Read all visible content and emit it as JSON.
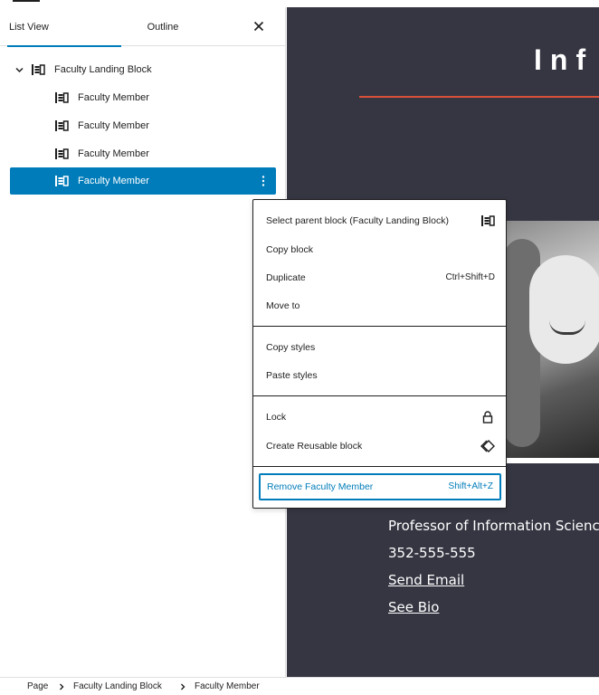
{
  "sidebar": {
    "tabs": [
      {
        "label": "List View",
        "active": true
      },
      {
        "label": "Outline",
        "active": false
      }
    ],
    "close_icon": "close-icon",
    "tree": [
      {
        "label": "Faculty Landing Block",
        "level": 1,
        "expanded": true
      },
      {
        "label": "Faculty Member",
        "level": 2
      },
      {
        "label": "Faculty Member",
        "level": 2
      },
      {
        "label": "Faculty Member",
        "level": 2
      },
      {
        "label": "Faculty Member",
        "level": 2,
        "selected": true
      }
    ]
  },
  "canvas": {
    "heading": "Inf",
    "info": [
      "Professor of Information Science",
      "352-555-555",
      "Send Email",
      "See Bio"
    ]
  },
  "menu": {
    "items": [
      {
        "label": "Select parent block (Faculty Landing Block)",
        "icon": "block-icon"
      },
      {
        "label": "Copy block"
      },
      {
        "label": "Duplicate",
        "shortcut": "Ctrl+Shift+D"
      },
      {
        "label": "Move to"
      },
      {
        "label": "Copy styles"
      },
      {
        "label": "Paste styles"
      },
      {
        "label": "Lock",
        "icon": "lock-icon"
      },
      {
        "label": "Create Reusable block",
        "icon": "reusable-icon"
      },
      {
        "label": "Remove Faculty Member",
        "shortcut": "Shift+Alt+Z"
      }
    ]
  },
  "breadcrumb": [
    "Page",
    "Faculty Landing Block",
    "Faculty Member"
  ],
  "colors": {
    "accent": "#007cba",
    "canvas_bg": "#353642",
    "heading_rule": "#d9503a",
    "text": "#1e1e1e"
  }
}
